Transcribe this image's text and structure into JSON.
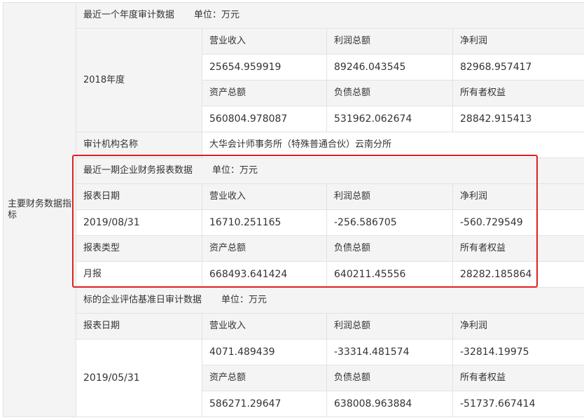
{
  "side_label": "主要财务数据指标",
  "annual": {
    "header_title": "最近一个年度审计数据",
    "header_unit": "单位：万元",
    "year": "2018年度",
    "row1_labels": [
      "营业收入",
      "利润总额",
      "净利润"
    ],
    "row1_values": [
      "25654.959919",
      "89246.043545",
      "82968.957417"
    ],
    "row2_labels": [
      "资产总额",
      "负债总额",
      "所有者权益"
    ],
    "row2_values": [
      "560804.978087",
      "531962.062674",
      "28842.915413"
    ],
    "auditor_label": "审计机构名称",
    "auditor_value": "大华会计师事务所（特殊普通合伙）云南分所"
  },
  "latest": {
    "header_title": "最近一期企业财务报表数据",
    "header_unit": "单位：万元",
    "date_label": "报表日期",
    "date_value": "2019/08/31",
    "type_label": "报表类型",
    "type_value": "月报",
    "row1_labels": [
      "营业收入",
      "利润总额",
      "净利润"
    ],
    "row1_values": [
      "16710.251165",
      "-256.586705",
      "-560.729549"
    ],
    "row2_labels": [
      "资产总额",
      "负债总额",
      "所有者权益"
    ],
    "row2_values": [
      "668493.641424",
      "640211.45556",
      "28282.185864"
    ]
  },
  "valuation": {
    "header_title": "标的企业评估基准日审计数据",
    "header_unit": "单位：万元",
    "date_label": "报表日期",
    "date_value": "2019/05/31",
    "row1_labels": [
      "营业收入",
      "利润总额",
      "净利润"
    ],
    "row1_values": [
      "4071.489439",
      "-33314.481574",
      "-32814.19975"
    ],
    "row2_labels": [
      "资产总额",
      "负债总额",
      "所有者权益"
    ],
    "row2_values": [
      "586271.29647",
      "638008.963884",
      "-51737.667414"
    ]
  },
  "colors": {
    "highlight_border": "#e02020",
    "label_bg": "#f4f4f4",
    "grid_line": "#e2e2e2"
  }
}
